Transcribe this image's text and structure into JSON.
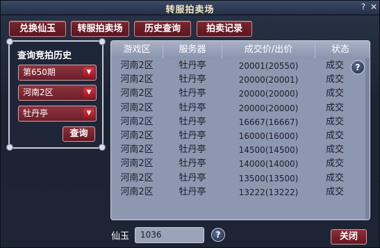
{
  "window": {
    "title": "转服拍卖场",
    "help_glyph": "?",
    "close_glyph": "✕"
  },
  "tabs": [
    {
      "label": "兑换仙玉"
    },
    {
      "label": "转服拍卖场"
    },
    {
      "label": "历史查询"
    },
    {
      "label": "拍卖记录"
    }
  ],
  "query_panel": {
    "heading": "查询竞拍历史",
    "period_select": "第650期",
    "region_select": "河南2区",
    "server_select": "牡丹亭",
    "query_button": "查询",
    "dropdown_arrow": "▼"
  },
  "table": {
    "columns": [
      "游戏区",
      "服务器",
      "成交价/出价",
      "状态"
    ],
    "rows": [
      {
        "zone": "河南2区",
        "server": "牡丹亭",
        "price": "20001(20550)",
        "status": "成交"
      },
      {
        "zone": "河南2区",
        "server": "牡丹亭",
        "price": "20000(20001)",
        "status": "成交"
      },
      {
        "zone": "河南2区",
        "server": "牡丹亭",
        "price": "20000(20000)",
        "status": "成交"
      },
      {
        "zone": "河南2区",
        "server": "牡丹亭",
        "price": "20000(20000)",
        "status": "成交"
      },
      {
        "zone": "河南2区",
        "server": "牡丹亭",
        "price": "16667(16667)",
        "status": "成交"
      },
      {
        "zone": "河南2区",
        "server": "牡丹亭",
        "price": "16000(16000)",
        "status": "成交"
      },
      {
        "zone": "河南2区",
        "server": "牡丹亭",
        "price": "14500(14500)",
        "status": "成交"
      },
      {
        "zone": "河南2区",
        "server": "牡丹亭",
        "price": "14000(14000)",
        "status": "成交"
      },
      {
        "zone": "河南2区",
        "server": "牡丹亭",
        "price": "13500(13500)",
        "status": "成交"
      },
      {
        "zone": "河南2区",
        "server": "牡丹亭",
        "price": "13222(13222)",
        "status": "成交"
      }
    ],
    "help_glyph": "?"
  },
  "footer": {
    "currency_label": "仙玉",
    "currency_value": "1036",
    "help_glyph": "?",
    "close_button": "关闭"
  },
  "colors": {
    "accent_red": "#7a2530",
    "table_bg": "#8d97b0",
    "title_text": "#f2e6c2"
  }
}
